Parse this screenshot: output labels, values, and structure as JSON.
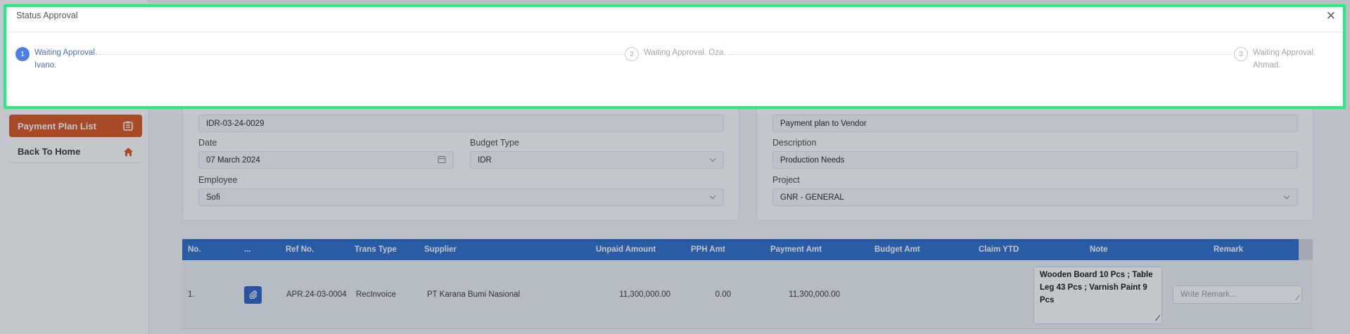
{
  "sidebar": {
    "items": [
      {
        "label": "Payment Plan List",
        "icon": "document-list-icon",
        "active": true
      },
      {
        "label": "Back To Home",
        "icon": "home-icon",
        "active": false
      }
    ]
  },
  "form": {
    "doc_number": "IDR-03-24-0029",
    "date_label": "Date",
    "date_value": "07 March 2024",
    "budget_type_label": "Budget Type",
    "budget_type_value": "IDR",
    "employee_label": "Employee",
    "employee_value": "Sofi",
    "payment_plan_value": "Payment plan to Vendor",
    "description_label": "Description",
    "description_value": "Production Needs",
    "project_label": "Project",
    "project_value": "GNR - GENERAL"
  },
  "table": {
    "headers": [
      "No.",
      "...",
      "Ref No.",
      "Trans Type",
      "Supplier",
      "Unpaid Amount",
      "PPH Amt",
      "Payment Amt",
      "Budget Amt",
      "Claim YTD",
      "Note",
      "Remark"
    ],
    "rows": [
      {
        "no": "1.",
        "ref_no": "APR.24-03-0004",
        "trans_type": "RecInvoice",
        "supplier": "PT Karana Bumi Nasional",
        "unpaid_amount": "11,300,000.00",
        "pph_amt": "0.00",
        "payment_amt": "11,300,000.00",
        "budget_amt": "",
        "claim_ytd": "",
        "note": "Wooden Board 10 Pcs ; Table Leg 43 Pcs ; Varnish Paint 9 Pcs",
        "remark_placeholder": "Write Remark..."
      }
    ]
  },
  "modal": {
    "title": "Status Approval",
    "close_symbol": "✕",
    "steps": [
      {
        "number": "1",
        "line1": "Waiting Approval.",
        "line2": "Ivano.",
        "active": true
      },
      {
        "number": "2",
        "line1": "Waiting Approval. Oza.",
        "line2": "",
        "active": false
      },
      {
        "number": "3",
        "line1": "Waiting Approval.",
        "line2": "Ahmad.",
        "active": false
      }
    ]
  },
  "colors": {
    "accent_blue": "#2a6cc9",
    "sidebar_active": "#d9541e",
    "modal_border": "#22ee7d",
    "step_active": "#4d7fe0"
  }
}
